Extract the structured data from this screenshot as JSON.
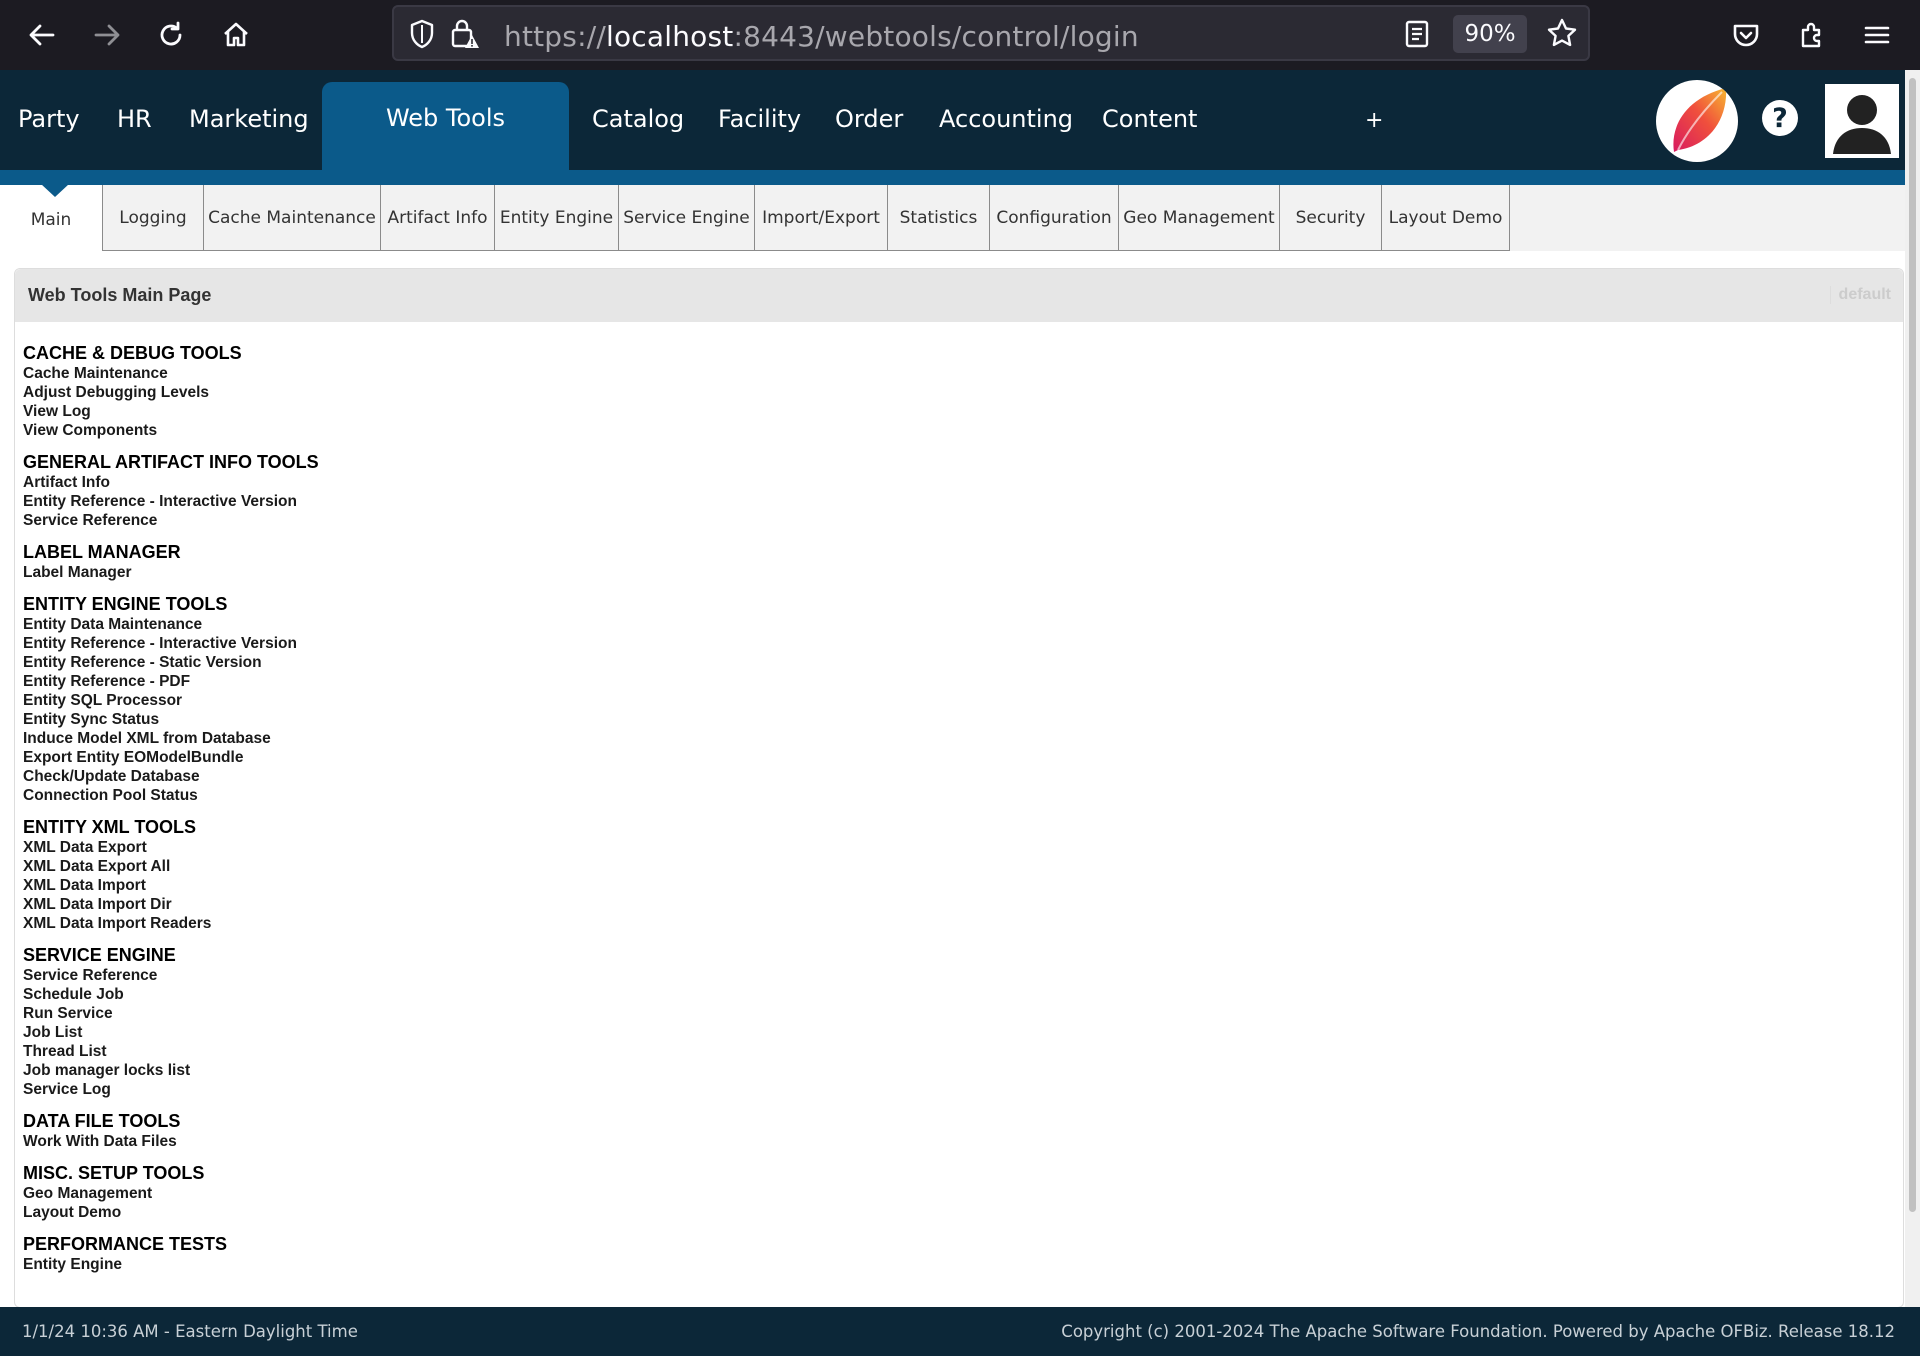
{
  "browser": {
    "url_prefix": "https://",
    "url_host": "localhost",
    "url_rest": ":8443/webtools/control/login",
    "zoom": "90%"
  },
  "app_menu": {
    "items": [
      "Party",
      "HR",
      "Marketing"
    ],
    "active": "Web Tools",
    "items_after": [
      "Catalog",
      "Facility",
      "Order",
      "Accounting",
      "Content"
    ],
    "plus": "+",
    "help": "?"
  },
  "subtabs": {
    "main": "Main",
    "items": [
      "Logging",
      "Cache Maintenance",
      "Artifact Info",
      "Entity Engine",
      "Service Engine",
      "Import/Export",
      "Statistics",
      "Configuration",
      "Geo Management",
      "Security",
      "Layout Demo"
    ]
  },
  "panel": {
    "title": "Web Tools Main Page",
    "default_label": "default"
  },
  "sections": [
    {
      "title": "CACHE & DEBUG TOOLS",
      "links": [
        "Cache Maintenance",
        "Adjust Debugging Levels",
        "View Log",
        "View Components"
      ]
    },
    {
      "title": "GENERAL ARTIFACT INFO TOOLS",
      "links": [
        "Artifact Info",
        "Entity Reference - Interactive Version",
        "Service Reference"
      ]
    },
    {
      "title": "LABEL MANAGER",
      "links": [
        "Label Manager"
      ]
    },
    {
      "title": "ENTITY ENGINE TOOLS",
      "links": [
        "Entity Data Maintenance",
        "Entity Reference - Interactive Version",
        "Entity Reference - Static Version",
        "Entity Reference - PDF",
        "Entity SQL Processor",
        "Entity Sync Status",
        "Induce Model XML from Database",
        "Export Entity EOModelBundle",
        "Check/Update Database",
        "Connection Pool Status"
      ]
    },
    {
      "title": "ENTITY XML TOOLS",
      "links": [
        "XML Data Export",
        "XML Data Export All",
        "XML Data Import",
        "XML Data Import Dir",
        "XML Data Import Readers"
      ]
    },
    {
      "title": "SERVICE ENGINE",
      "links": [
        "Service Reference",
        "Schedule Job",
        "Run Service",
        "Job List",
        "Thread List",
        "Job manager locks list",
        "Service Log"
      ]
    },
    {
      "title": "DATA FILE TOOLS",
      "links": [
        "Work With Data Files"
      ]
    },
    {
      "title": "MISC. SETUP TOOLS",
      "links": [
        "Geo Management",
        "Layout Demo"
      ]
    },
    {
      "title": "PERFORMANCE TESTS",
      "links": [
        "Entity Engine"
      ]
    }
  ],
  "footer": {
    "datetime": "1/1/24 10:36 AM - Eastern Daylight Time",
    "copyright": "Copyright (c) 2001-2024 The Apache Software Foundation. Powered by Apache OFBiz. Release 18.12"
  },
  "colors": {
    "header_bg": "#0c2738",
    "accent": "#0b5a8a",
    "browser_bg": "#1c1b22"
  },
  "icons": {
    "back": "arrow-left-icon",
    "forward": "arrow-right-icon",
    "reload": "reload-icon",
    "home": "home-icon",
    "shield": "shield-icon",
    "lock": "lock-warning-icon",
    "reader": "reader-view-icon",
    "bookmark": "star-icon",
    "pocket": "pocket-icon",
    "extensions": "puzzle-icon",
    "menu": "hamburger-menu-icon"
  }
}
